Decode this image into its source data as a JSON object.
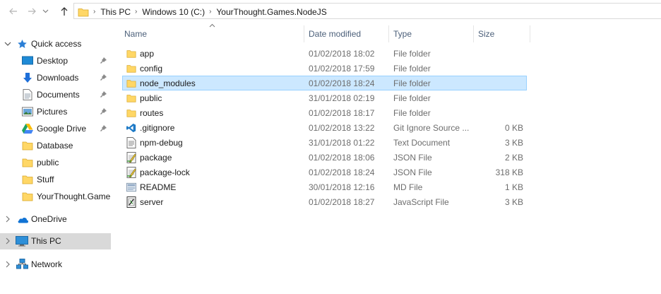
{
  "breadcrumb": [
    "This PC",
    "Windows 10 (C:)",
    "YourThought.Games.NodeJS"
  ],
  "sidebar": {
    "quick_access": "Quick access",
    "items": [
      {
        "label": "Desktop",
        "icon": "desktop-icon",
        "pinned": true
      },
      {
        "label": "Downloads",
        "icon": "downloads-icon",
        "pinned": true
      },
      {
        "label": "Documents",
        "icon": "documents-icon",
        "pinned": true
      },
      {
        "label": "Pictures",
        "icon": "pictures-icon",
        "pinned": true
      },
      {
        "label": "Google Drive",
        "icon": "google-drive-icon",
        "pinned": true
      },
      {
        "label": "Database",
        "icon": "folder-icon",
        "pinned": false
      },
      {
        "label": "public",
        "icon": "folder-icon",
        "pinned": false
      },
      {
        "label": "Stuff",
        "icon": "folder-icon",
        "pinned": false
      },
      {
        "label": "YourThought.Game",
        "icon": "folder-icon",
        "pinned": false
      }
    ],
    "onedrive": "OneDrive",
    "this_pc": "This PC",
    "network": "Network"
  },
  "columns": {
    "name": "Name",
    "date": "Date modified",
    "type": "Type",
    "size": "Size"
  },
  "files": [
    {
      "name": "app",
      "date": "01/02/2018 18:02",
      "type": "File folder",
      "size": "",
      "icon": "folder-icon"
    },
    {
      "name": "config",
      "date": "01/02/2018 17:59",
      "type": "File folder",
      "size": "",
      "icon": "folder-icon"
    },
    {
      "name": "node_modules",
      "date": "01/02/2018 18:24",
      "type": "File folder",
      "size": "",
      "icon": "folder-icon",
      "selected": true
    },
    {
      "name": "public",
      "date": "31/01/2018 02:19",
      "type": "File folder",
      "size": "",
      "icon": "folder-icon"
    },
    {
      "name": "routes",
      "date": "01/02/2018 18:17",
      "type": "File folder",
      "size": "",
      "icon": "folder-icon"
    },
    {
      "name": ".gitignore",
      "date": "01/02/2018 13:22",
      "type": "Git Ignore Source ...",
      "size": "0 KB",
      "icon": "vscode-file-icon"
    },
    {
      "name": "npm-debug",
      "date": "31/01/2018 01:22",
      "type": "Text Document",
      "size": "3 KB",
      "icon": "text-file-icon"
    },
    {
      "name": "package",
      "date": "01/02/2018 18:06",
      "type": "JSON File",
      "size": "2 KB",
      "icon": "json-file-icon"
    },
    {
      "name": "package-lock",
      "date": "01/02/2018 18:24",
      "type": "JSON File",
      "size": "318 KB",
      "icon": "json-file-icon"
    },
    {
      "name": "README",
      "date": "30/01/2018 12:16",
      "type": "MD File",
      "size": "1 KB",
      "icon": "md-file-icon"
    },
    {
      "name": "server",
      "date": "01/02/2018 18:27",
      "type": "JavaScript File",
      "size": "3 KB",
      "icon": "js-file-icon"
    }
  ],
  "colors": {
    "selection_bg": "#cce8ff",
    "selection_border": "#99d1ff",
    "folder": "#ffd766",
    "sidebar_selected": "#d9d9d9",
    "header_text": "#4c607a"
  }
}
